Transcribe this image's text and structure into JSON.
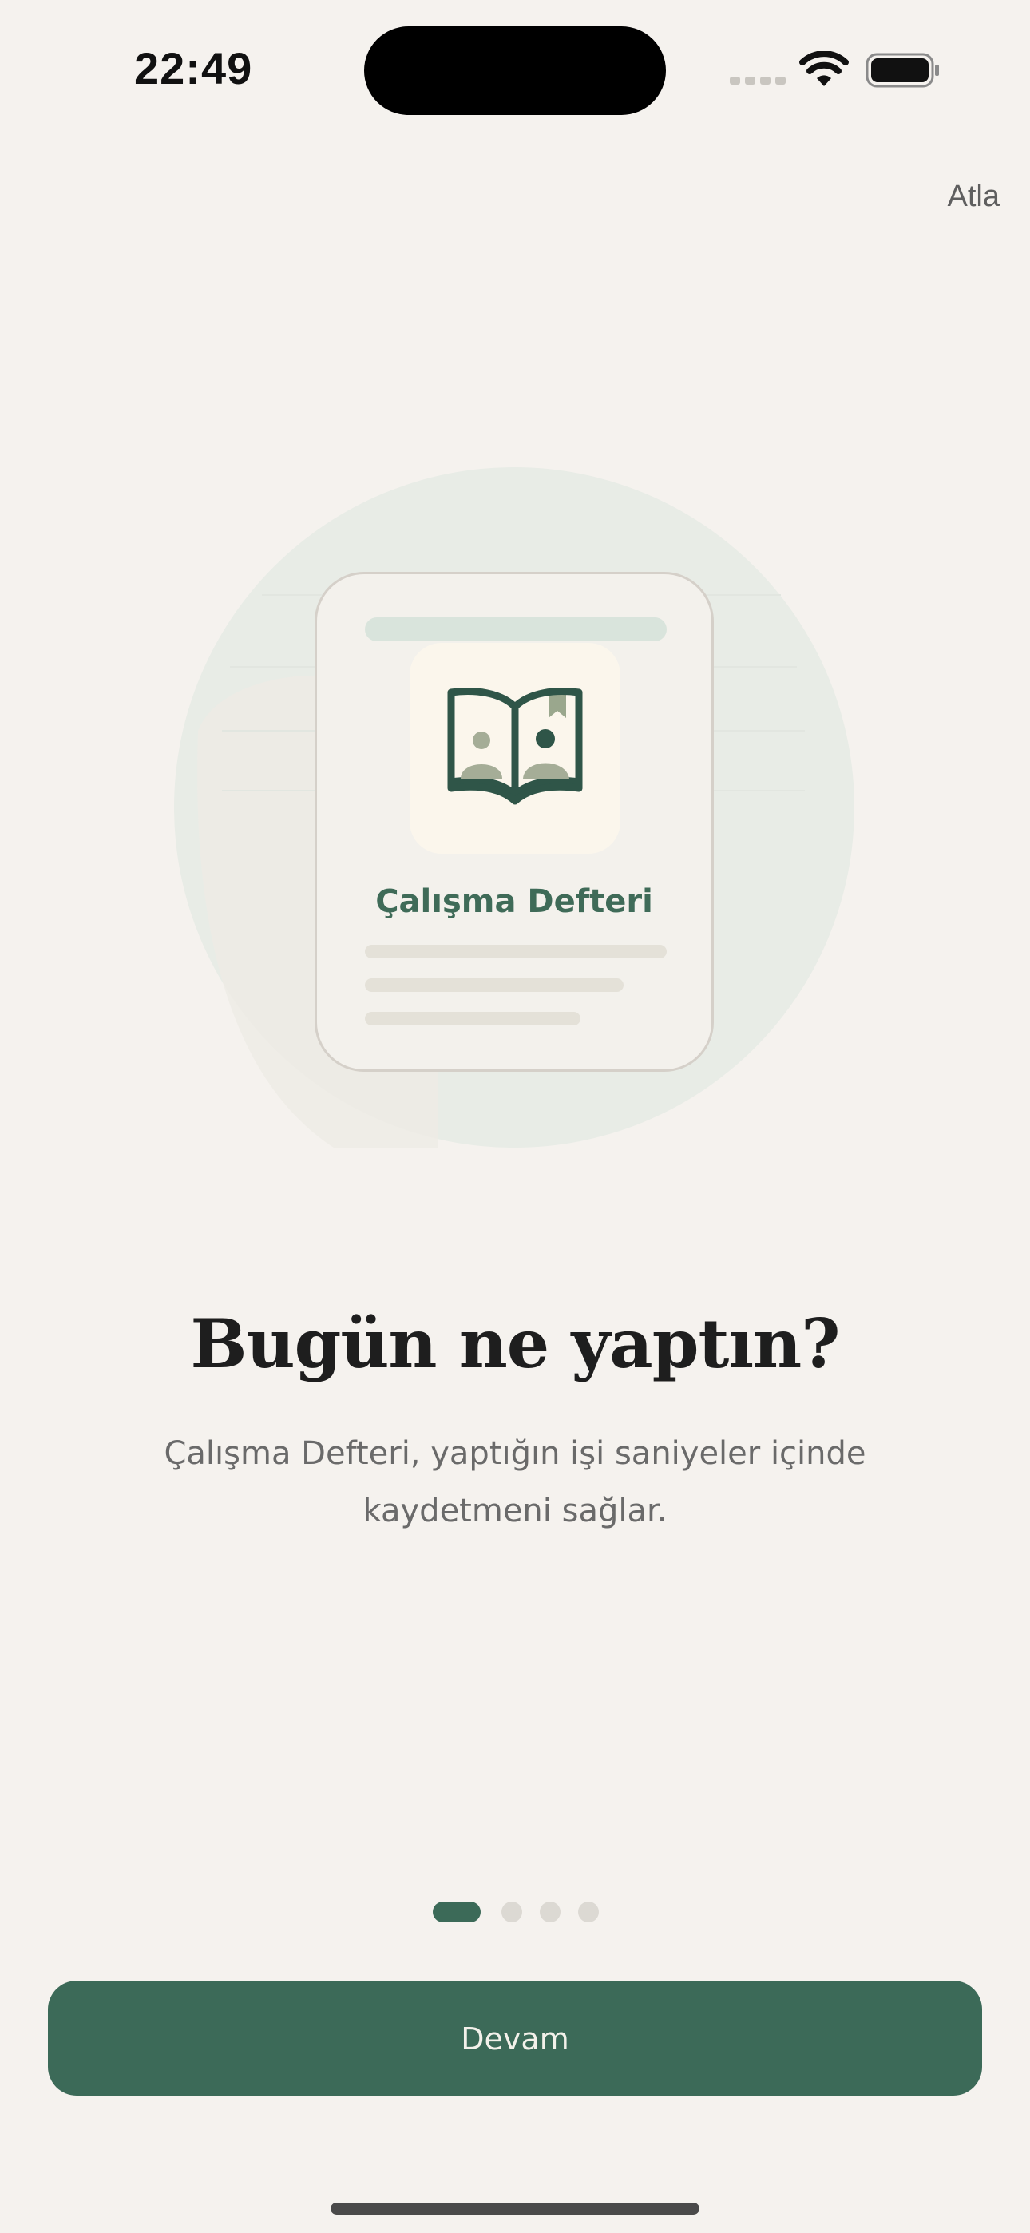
{
  "status_bar": {
    "time": "22:49",
    "icons": [
      "signal-icon",
      "wifi-icon",
      "battery-icon"
    ]
  },
  "header": {
    "skip_label": "Atla"
  },
  "illustration": {
    "card_title": "Çalışma Defteri",
    "icon": "book-with-people-icon"
  },
  "content": {
    "title": "Bugün ne yaptın?",
    "description": "Çalışma Defteri, yaptığın işi saniyeler içinde kaydetmeni sağlar."
  },
  "pagination": {
    "current_page": 1,
    "total_pages": 4
  },
  "footer": {
    "continue_label": "Devam"
  },
  "colors": {
    "background": "#f5f2ee",
    "accent": "#3c6a58",
    "text_primary": "#1e1e1e",
    "text_secondary": "#6a6a6a"
  }
}
